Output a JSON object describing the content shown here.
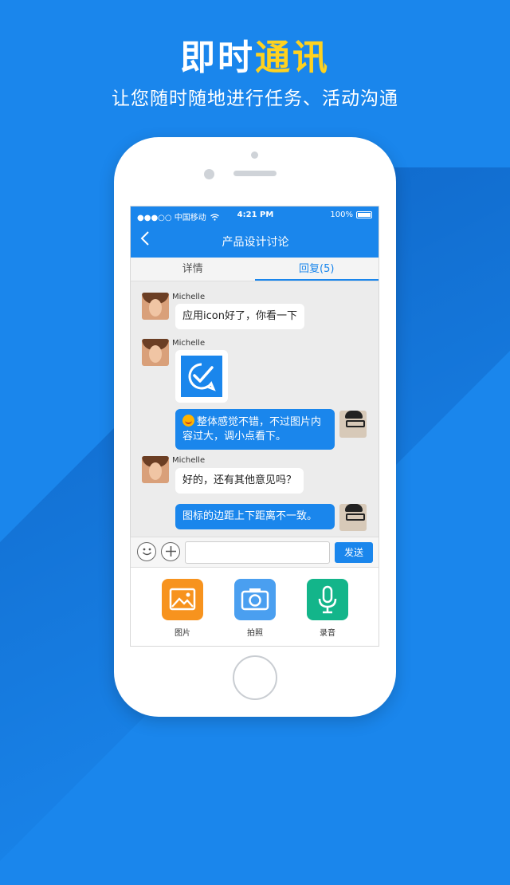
{
  "hero": {
    "title_white": "即时",
    "title_yellow": "通讯",
    "subtitle": "让您随时随地进行任务、活动沟通"
  },
  "status_bar": {
    "carrier": "●●●○○ 中国移动",
    "wifi_icon": "wifi-icon",
    "time": "4:21 PM",
    "battery": "100%"
  },
  "nav": {
    "back_icon": "chevron-left-icon",
    "title": "产品设计讨论"
  },
  "tabs": [
    {
      "label": "详情",
      "active": false
    },
    {
      "label": "回复(5)",
      "active": true
    }
  ],
  "messages": [
    {
      "sender": "Michelle",
      "direction": "incoming",
      "type": "text",
      "text": "应用icon好了，你看一下"
    },
    {
      "sender": "Michelle",
      "direction": "incoming",
      "type": "image",
      "image_icon": "chat-check-logo-icon"
    },
    {
      "sender": "",
      "direction": "outgoing",
      "type": "text",
      "emoji_icon": "smiley-emoji-icon",
      "text_line1": "整体感觉不错，不过图片内",
      "text_line2": "容过大，调小点看下。"
    },
    {
      "sender": "Michelle",
      "direction": "incoming",
      "type": "text",
      "text": "好的，还有其他意见吗？"
    },
    {
      "sender": "",
      "direction": "outgoing",
      "type": "text",
      "text": "图标的边距上下距离不一致。"
    }
  ],
  "input_bar": {
    "emoji_icon": "smiley-icon",
    "plus_icon": "plus-icon",
    "value": "",
    "send_label": "发送"
  },
  "tools": [
    {
      "label": "图片",
      "icon": "picture-icon",
      "color": "#f7931e"
    },
    {
      "label": "拍照",
      "icon": "camera-icon",
      "color": "#4a9ff0"
    },
    {
      "label": "录音",
      "icon": "microphone-icon",
      "color": "#13b58a"
    }
  ],
  "colors": {
    "background": "#1a86ec",
    "accent_yellow": "#ffd21f",
    "bubble_out": "#1a86ec",
    "bubble_in": "#ffffff"
  }
}
